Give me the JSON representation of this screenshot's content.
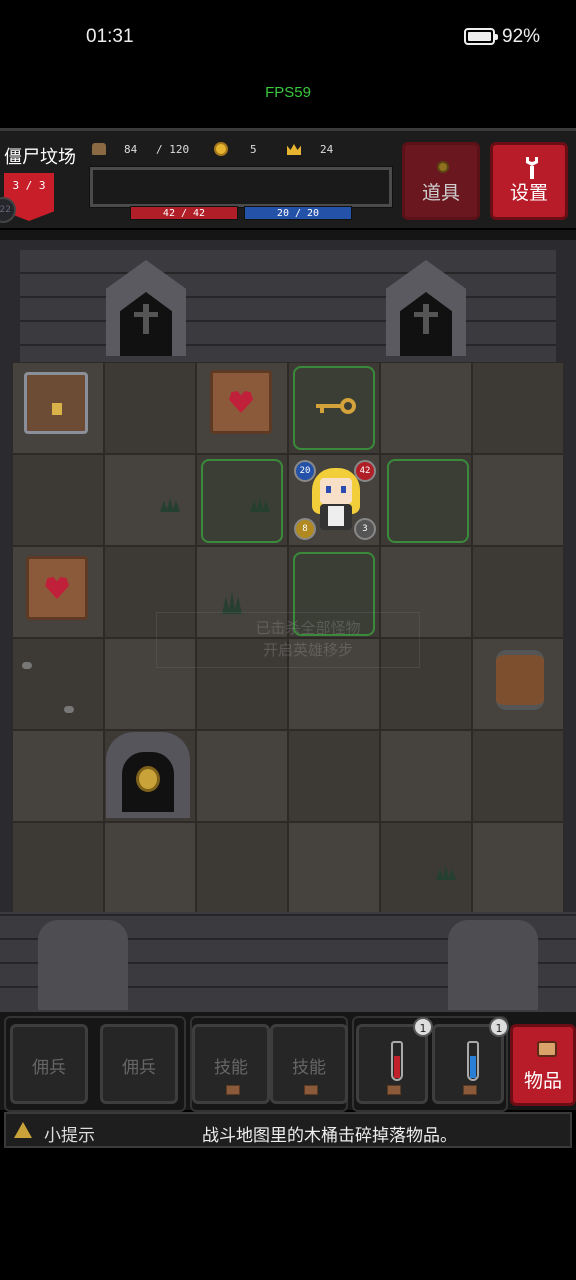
{
  "status_bar": {
    "time": "01:31",
    "battery": "92%",
    "battery_level": 0.92
  },
  "fps": "FPS59",
  "hud": {
    "location": "僵尸坟场",
    "floor_progress": "3 / 3",
    "side_badge": "22",
    "stats": {
      "food": "84",
      "food_max": "/ 120",
      "gold": "5",
      "crowns": "24"
    },
    "hp": "42 / 42",
    "mp": "20 / 20",
    "items_button": "道具",
    "settings_button": "设置",
    "colors": {
      "accent_red": "#b81c28",
      "hp": "#b01e28",
      "mp": "#2452a8",
      "move_highlight": "#3b8a3b"
    }
  },
  "board": {
    "hero": {
      "hp": "42",
      "mp": "20",
      "atk": "8",
      "def": "3"
    },
    "faded_notice": [
      "已击杀全部怪物",
      "开启英雄移步"
    ],
    "objects": [
      "chest",
      "heart-scroll",
      "heart-scroll",
      "key",
      "barrel",
      "shrine",
      "shrine-arch",
      "shrine-arch"
    ]
  },
  "actionbar": {
    "slots": [
      "佣兵",
      "佣兵",
      "技能",
      "技能"
    ],
    "potions": [
      {
        "color": "#c0202a",
        "count": "1"
      },
      {
        "color": "#2a7fd6",
        "count": "1"
      }
    ],
    "bag_button": "物品"
  },
  "hint": {
    "label": "小提示",
    "text": "战斗地图里的木桶击碎掉落物品。"
  }
}
